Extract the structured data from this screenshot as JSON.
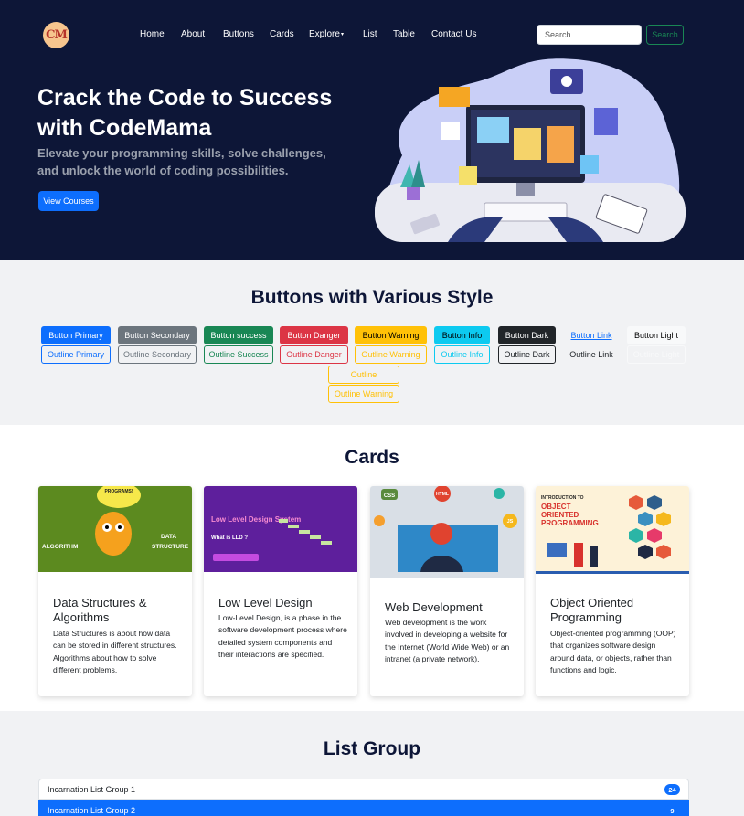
{
  "brand": {
    "logo_text": "CM"
  },
  "nav": {
    "items": [
      "Home",
      "About",
      "Buttons",
      "Cards",
      "Explore",
      "List",
      "Table",
      "Contact Us"
    ],
    "search_placeholder": "Search",
    "search_button": "Search"
  },
  "hero": {
    "title": "Crack the Code to Success with CodeMama",
    "subtitle": "Elevate your programming skills, solve challenges, and unlock the world of coding possibilities.",
    "cta": "View Courses"
  },
  "buttons_section": {
    "title": "Buttons with Various Style",
    "solid": [
      "Button Primary",
      "Button Secondary",
      "Button success",
      "Button Danger",
      "Button Warning",
      "Button Info",
      "Button Dark",
      "Button Link",
      "Button Light"
    ],
    "outline": [
      "Outline Primary",
      "Outline Secondary",
      "Outline Success",
      "Outline Danger",
      "Outline Warning",
      "Outline Info",
      "Outline Dark",
      "Outline Link",
      "Outline Light"
    ],
    "extra": [
      "Outline",
      "Outline Warning"
    ]
  },
  "cards_section": {
    "title": "Cards",
    "cards": [
      {
        "title": "Data Structures & Algorithms",
        "text": "Data Structures is about how data can be stored in different structures. Algorithms about how to solve different problems.",
        "img_labels": [
          "PROGRAMS!",
          "ALGORITHM",
          "DATA",
          "STRUCTURE"
        ]
      },
      {
        "title": "Low Level Design",
        "text": "Low-Level Design, is a phase in the software development process where detailed system components and their interactions are specified.",
        "img_labels": [
          "Low Level Design System",
          "What is LLD ?"
        ]
      },
      {
        "title": "Web Development",
        "text": "Web development is the work involved in developing a website for the Internet (World Wide Web) or an intranet (a private network).",
        "img_labels": [
          "CSS",
          "HTML",
          "JS"
        ]
      },
      {
        "title": "Object Oriented Programming",
        "text": "Object-oriented programming (OOP) that organizes software design around data, or objects, rather than functions and logic.",
        "img_labels": [
          "INTRODUCTION TO",
          "OBJECT ORIENTED PROGRAMMING"
        ]
      }
    ]
  },
  "list_section": {
    "title": "List Group",
    "items": [
      {
        "label": "Incarnation List Group 1",
        "badge": "24"
      },
      {
        "label": "Incarnation List Group 2",
        "badge": "9"
      }
    ]
  },
  "colors": {
    "primary": "#0d6efd",
    "secondary": "#6c757d",
    "success": "#198754",
    "danger": "#dc3545",
    "warning": "#ffc107",
    "info": "#0dcaf0",
    "dark": "#212529",
    "navy": "#0d1637"
  }
}
